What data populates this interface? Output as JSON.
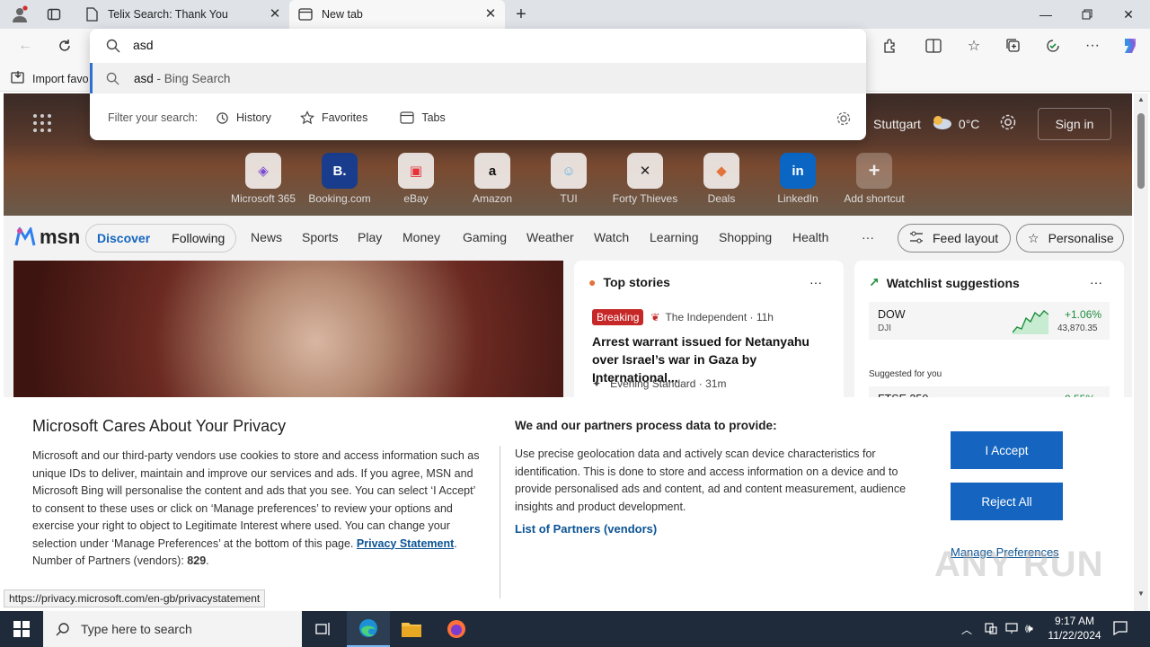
{
  "tabs": [
    {
      "title": "Telix Search: Thank You"
    },
    {
      "title": "New tab"
    }
  ],
  "omnibox": {
    "query": "asd",
    "suggestion_query": "asd",
    "suggestion_suffix": " - Bing Search",
    "filter_label": "Filter your search:",
    "filters": [
      "History",
      "Favorites",
      "Tabs"
    ]
  },
  "favbar": {
    "import_label": "Import favo"
  },
  "ntp": {
    "weather_city": "Stuttgart",
    "weather_temp": "0°C",
    "sign_in": "Sign in",
    "shortcuts": [
      "Microsoft 365",
      "Booking.com",
      "eBay",
      "Amazon",
      "TUI",
      "Forty Thieves",
      "Deals",
      "LinkedIn",
      "Add shortcut"
    ],
    "msn_logo": "msn",
    "feed_tabs": [
      "Discover",
      "Following"
    ],
    "nav_links": [
      "News",
      "Sports",
      "Play",
      "Money",
      "Gaming",
      "Weather",
      "Watch",
      "Learning",
      "Shopping",
      "Health"
    ],
    "more": "···",
    "feed_layout": "Feed layout",
    "personalise": "Personalise",
    "top_stories": {
      "title": "Top stories",
      "badge": "Breaking",
      "source": "The Independent · 11h",
      "headline": "Arrest warrant issued for Netanyahu over Israel’s war in Gaza by International...",
      "source2": "Evening Standard · 31m"
    },
    "watchlist": {
      "title": "Watchlist suggestions",
      "ticker": "DOW",
      "ticker_sub": "DJI",
      "change": "+1.06%",
      "price": "43,870.35",
      "suggested": "Suggested for you",
      "ticker2": "FTSE 250",
      "change2": "0.55%"
    }
  },
  "privacy": {
    "title": "Microsoft Cares About Your Privacy",
    "body": "Microsoft and our third-party vendors use cookies to store and access information such as unique IDs to deliver, maintain and improve our services and ads. If you agree, MSN and Microsoft Bing will personalise the content and ads that you see. You can select ‘I Accept’ to consent to these uses or click on ‘Manage preferences’ to review your options and exercise your right to object to Legitimate Interest where used. You can change your selection under ‘Manage Preferences’ at the bottom of this page.",
    "privacy_link": "Privacy Statement",
    "partners_label": "Number of Partners (vendors):",
    "partners_count": "829",
    "right_title": "We and our partners process data to provide:",
    "right_body": "Use precise geolocation data and actively scan device characteristics for identification. This is done to store and access information on a device and to provide personalised ads and content, ad and content measurement, audience insights and product development.",
    "partners_link": "List of Partners (vendors)",
    "accept": "I Accept",
    "reject": "Reject All",
    "manage": "Manage Preferences"
  },
  "status_url": "https://privacy.microsoft.com/en-gb/privacystatement",
  "watermark": "ANY RUN",
  "taskbar": {
    "search_placeholder": "Type here to search",
    "time": "9:17 AM",
    "date": "11/22/2024"
  },
  "colors": {
    "accent": "#1565c0",
    "link": "#0b5394",
    "taskbar": "#1f2b3a",
    "breaking": "#c62828",
    "stock_up": "#1e8e3e"
  }
}
